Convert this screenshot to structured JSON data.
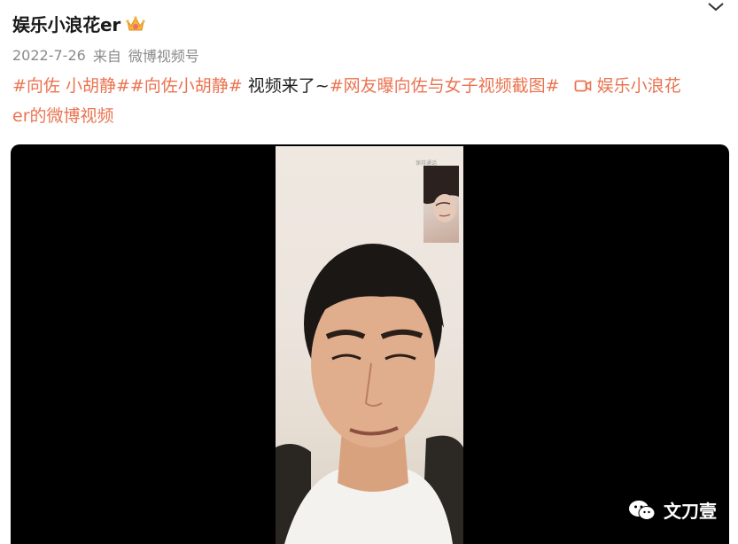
{
  "post": {
    "username": "娱乐小浪花er",
    "date": "2022-7-26",
    "from_label": "来自",
    "source": "微博视频号",
    "text": {
      "tag1": "#向佐 小胡静#",
      "tag2": "#向佐小胡静#",
      "plain": "视频来了~",
      "tag3": "#网友曝向佐与女子视频截图#",
      "link_line1": "娱乐小浪花",
      "link_line2": "er的微博视频"
    }
  },
  "video": {
    "pip_label": "保持通话",
    "watermark": "文刀壹"
  },
  "icons": {
    "crown": "crown-icon",
    "chevron": "chevron-down-icon",
    "video": "video-icon",
    "wechat": "wechat-icon"
  },
  "colors": {
    "tag": "#eb7350",
    "meta": "#8a8a8a",
    "video_bg": "#000000"
  }
}
